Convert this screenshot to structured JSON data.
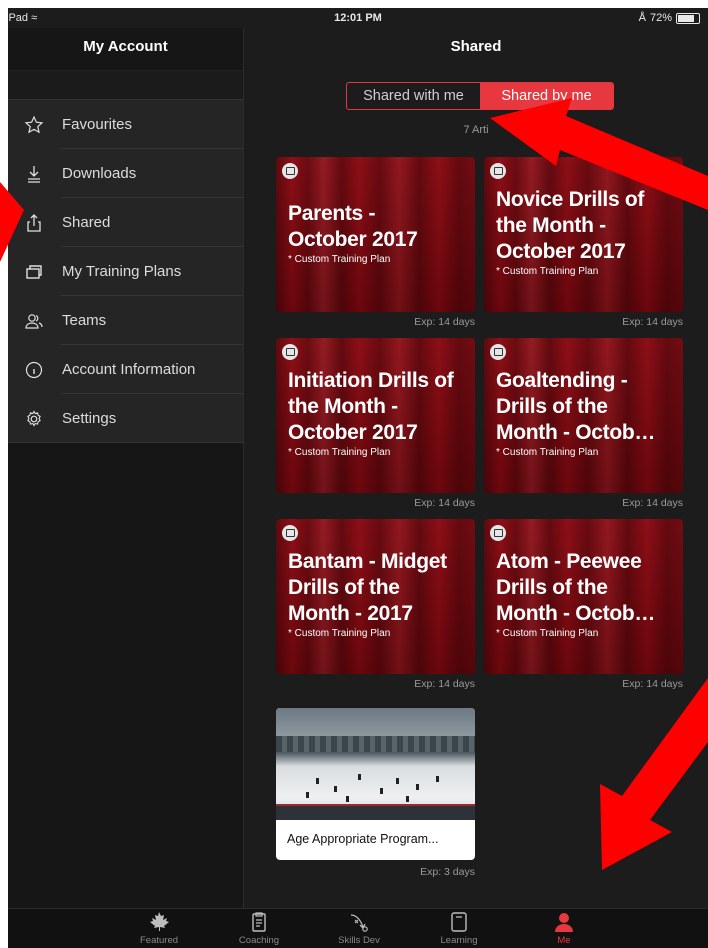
{
  "status_bar": {
    "device": "iPad",
    "time": "12:01 PM",
    "battery": "72%",
    "battery_level": 0.72
  },
  "sidebar": {
    "title": "My Account",
    "items": [
      {
        "label": "Favourites",
        "icon": "star-icon"
      },
      {
        "label": "Downloads",
        "icon": "download-icon"
      },
      {
        "label": "Shared",
        "icon": "share-icon"
      },
      {
        "label": "My Training Plans",
        "icon": "stack-icon"
      },
      {
        "label": "Teams",
        "icon": "people-icon"
      },
      {
        "label": "Account Information",
        "icon": "info-icon"
      },
      {
        "label": "Settings",
        "icon": "gear-icon"
      }
    ]
  },
  "main": {
    "title": "Shared",
    "segments": [
      "Shared with me",
      "Shared by me"
    ],
    "active_segment": "Shared by me",
    "count_label": "7 Arti",
    "cards": [
      {
        "title": "Parents -\nOctober 2017",
        "subtitle": "* Custom Training Plan",
        "expiry": "Exp: 14 days"
      },
      {
        "title": "Novice Drills of\nthe Month -\nOctober 2017",
        "subtitle": "* Custom Training Plan",
        "expiry": "Exp: 14 days"
      },
      {
        "title": "Initiation Drills of\nthe Month -\nOctober 2017",
        "subtitle": "* Custom Training Plan",
        "expiry": "Exp: 14 days"
      },
      {
        "title": "Goaltending -\nDrills of the\nMonth - Octob…",
        "subtitle": "* Custom Training Plan",
        "expiry": "Exp: 14 days"
      },
      {
        "title": "Bantam - Midget\nDrills of the\nMonth - 2017",
        "subtitle": "* Custom Training Plan",
        "expiry": "Exp: 14 days"
      },
      {
        "title": "Atom - Peewee\nDrills of the\nMonth - Octob…",
        "subtitle": "* Custom Training Plan",
        "expiry": "Exp: 14 days"
      }
    ],
    "photo_card": {
      "label": "Age Appropriate Program...",
      "expiry": "Exp: 3 days"
    }
  },
  "tabbar": {
    "items": [
      {
        "label": "Featured",
        "icon": "maple-leaf-icon"
      },
      {
        "label": "Coaching",
        "icon": "clipboard-icon"
      },
      {
        "label": "Skills Dev",
        "icon": "play-diagram-icon"
      },
      {
        "label": "Learning",
        "icon": "tablet-icon"
      },
      {
        "label": "Me",
        "icon": "person-icon"
      }
    ],
    "active": "Me"
  },
  "colors": {
    "accent": "#e8383f",
    "card_red": "#7a0a10",
    "background": "#1c1c1c",
    "sidebar": "#252525"
  }
}
